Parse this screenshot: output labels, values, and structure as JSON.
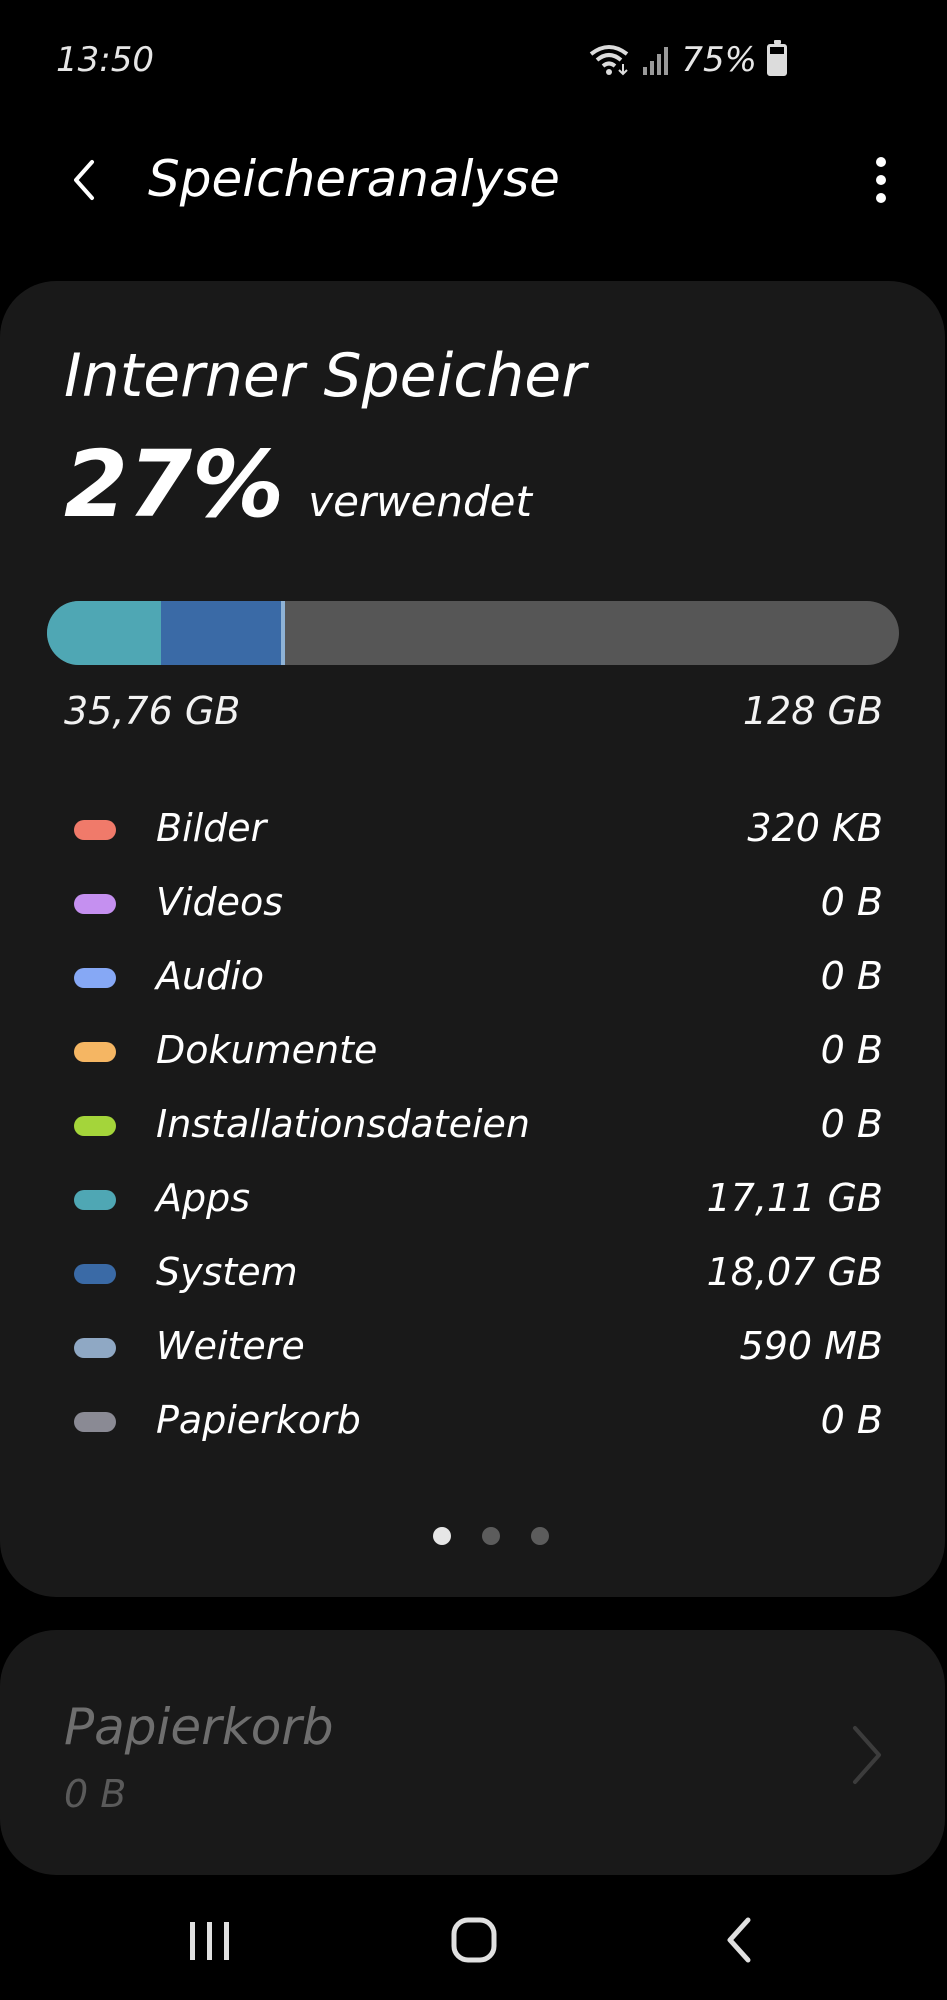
{
  "status_bar": {
    "time": "13:50",
    "battery_percent": "75%",
    "battery_level": 0.75,
    "icons": [
      "wifi-icon",
      "signal-icon",
      "battery-icon"
    ]
  },
  "app_bar": {
    "title": "Speicheranalyse",
    "back_icon": "back-arrow-icon",
    "menu_icon": "more-vert-icon"
  },
  "storage": {
    "heading": "Interner Speicher",
    "percent": "27%",
    "percent_suffix": "verwendet",
    "used": "35,76 GB",
    "total": "128 GB",
    "bar_segments": [
      {
        "name": "Apps",
        "fraction": 0.1337,
        "color": "#4fa7b4"
      },
      {
        "name": "System",
        "fraction": 0.1412,
        "color": "#3a6aa6"
      },
      {
        "name": "Weitere",
        "fraction": 0.0046,
        "color": "#8fb3d6"
      }
    ],
    "categories": [
      {
        "label": "Bilder",
        "size": "320 KB",
        "color": "#f07a6a"
      },
      {
        "label": "Videos",
        "size": "0 B",
        "color": "#c590f0"
      },
      {
        "label": "Audio",
        "size": "0 B",
        "color": "#86a8f5"
      },
      {
        "label": "Dokumente",
        "size": "0 B",
        "color": "#f5b663"
      },
      {
        "label": "Installationsdateien",
        "size": "0 B",
        "color": "#a4d53a"
      },
      {
        "label": "Apps",
        "size": "17,11 GB",
        "color": "#4fa7b4"
      },
      {
        "label": "System",
        "size": "18,07 GB",
        "color": "#3a6aa6"
      },
      {
        "label": "Weitere",
        "size": "590 MB",
        "color": "#8fa8c4"
      },
      {
        "label": "Papierkorb",
        "size": "0 B",
        "color": "#8a8a94"
      }
    ],
    "pages": {
      "count": 3,
      "active": 0
    }
  },
  "trash": {
    "title": "Papierkorb",
    "size": "0 B",
    "chevron_icon": "chevron-right-icon"
  },
  "nav_bar": {
    "recents_icon": "recents-icon",
    "home_icon": "home-icon",
    "back_icon": "nav-back-icon"
  }
}
